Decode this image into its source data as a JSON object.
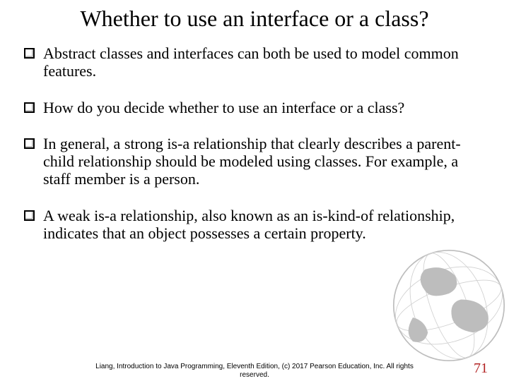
{
  "title": "Whether to use an interface or a class?",
  "bullets": [
    "Abstract classes and interfaces can both be used to model common features.",
    "How do you decide whether to use an interface or a class?",
    "In general, a strong is-a relationship that clearly describes a parent-child relationship should be modeled using classes. For example, a staff member is a person.",
    "A weak is-a relationship, also known as an is-kind-of relationship, indicates that an object possesses a certain property."
  ],
  "footer": "Liang, Introduction to Java Programming, Eleventh Edition, (c) 2017 Pearson Education, Inc. All rights reserved.",
  "page_number": "71"
}
